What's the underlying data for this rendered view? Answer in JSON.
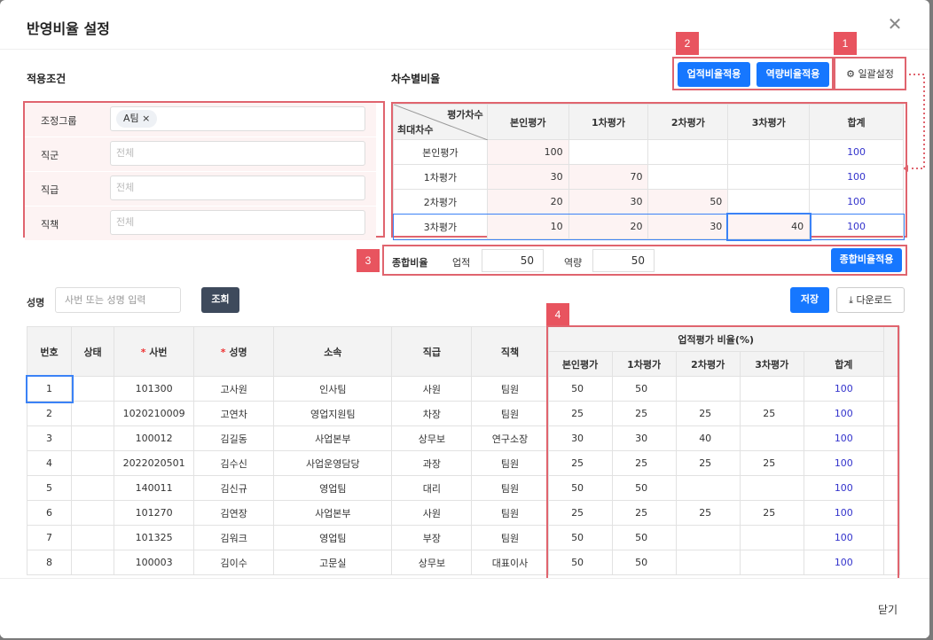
{
  "modal": {
    "title": "반영비율 설정",
    "close_label": "닫기"
  },
  "sections": {
    "conditions": "적용조건",
    "ratio": "차수별비율",
    "name": "성명"
  },
  "badges": [
    "1",
    "2",
    "3",
    "4"
  ],
  "buttons": {
    "perf_apply": "업적비율적용",
    "comp_apply": "역량비율적용",
    "bulk": "일괄설정",
    "total_apply": "종합비율적용",
    "search": "조회",
    "save": "저장",
    "download": "다운로드"
  },
  "conditions": [
    {
      "label": "조정그룹",
      "tag": "A팀",
      "placeholder": ""
    },
    {
      "label": "직군",
      "placeholder": "전체"
    },
    {
      "label": "직급",
      "placeholder": "전체"
    },
    {
      "label": "직책",
      "placeholder": "전체"
    }
  ],
  "ratio_table": {
    "corner_top": "평가차수",
    "corner_bottom": "최대차수",
    "headers": [
      "본인평가",
      "1차평가",
      "2차평가",
      "3차평가",
      "합계"
    ],
    "rows": [
      {
        "name": "본인평가",
        "values": [
          "100",
          "",
          "",
          ""
        ],
        "total": "100"
      },
      {
        "name": "1차평가",
        "values": [
          "30",
          "70",
          "",
          ""
        ],
        "total": "100"
      },
      {
        "name": "2차평가",
        "values": [
          "20",
          "30",
          "50",
          ""
        ],
        "total": "100"
      },
      {
        "name": "3차평가",
        "values": [
          "10",
          "20",
          "30",
          "40"
        ],
        "total": "100"
      }
    ]
  },
  "total_ratio": {
    "label": "종합비율",
    "perf_label": "업적",
    "perf_value": "50",
    "comp_label": "역량",
    "comp_value": "50"
  },
  "search": {
    "placeholder": "사번 또는 성명 입력"
  },
  "grid": {
    "headers": [
      "번호",
      "상태",
      "사번",
      "성명",
      "소속",
      "직급",
      "직책"
    ],
    "group_header": "업적평가 비율(%)",
    "sub_headers": [
      "본인평가",
      "1차평가",
      "2차평가",
      "3차평가",
      "합계"
    ],
    "rows": [
      {
        "no": "1",
        "status": "",
        "id": "101300",
        "name": "고사원",
        "dept": "인사팀",
        "rank": "사원",
        "title": "팀원",
        "r": [
          "50",
          "50",
          "",
          ""
        ],
        "total": "100"
      },
      {
        "no": "2",
        "status": "",
        "id": "1020210009",
        "name": "고연차",
        "dept": "영업지원팀",
        "rank": "차장",
        "title": "팀원",
        "r": [
          "25",
          "25",
          "25",
          "25"
        ],
        "total": "100"
      },
      {
        "no": "3",
        "status": "",
        "id": "100012",
        "name": "김길동",
        "dept": "사업본부",
        "rank": "상무보",
        "title": "연구소장",
        "r": [
          "30",
          "30",
          "40",
          ""
        ],
        "total": "100"
      },
      {
        "no": "4",
        "status": "",
        "id": "2022020501",
        "name": "김수신",
        "dept": "사업운영담당",
        "rank": "과장",
        "title": "팀원",
        "r": [
          "25",
          "25",
          "25",
          "25"
        ],
        "total": "100"
      },
      {
        "no": "5",
        "status": "",
        "id": "140011",
        "name": "김신규",
        "dept": "영업팀",
        "rank": "대리",
        "title": "팀원",
        "r": [
          "50",
          "50",
          "",
          ""
        ],
        "total": "100"
      },
      {
        "no": "6",
        "status": "",
        "id": "101270",
        "name": "김연장",
        "dept": "사업본부",
        "rank": "사원",
        "title": "팀원",
        "r": [
          "25",
          "25",
          "25",
          "25"
        ],
        "total": "100"
      },
      {
        "no": "7",
        "status": "",
        "id": "101325",
        "name": "김워크",
        "dept": "영업팀",
        "rank": "부장",
        "title": "팀원",
        "r": [
          "50",
          "50",
          "",
          ""
        ],
        "total": "100"
      },
      {
        "no": "8",
        "status": "",
        "id": "100003",
        "name": "김이수",
        "dept": "고문실",
        "rank": "상무보",
        "title": "대표이사",
        "r": [
          "50",
          "50",
          "",
          ""
        ],
        "total": "100"
      }
    ]
  }
}
